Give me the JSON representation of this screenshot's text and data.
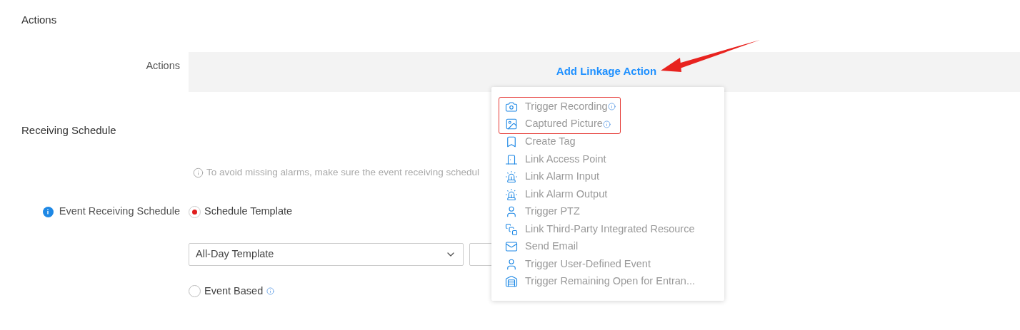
{
  "actions_section": {
    "heading": "Actions",
    "label": "Actions",
    "add_link": "Add Linkage Action"
  },
  "linkage_menu": {
    "items": [
      {
        "kind": "camera",
        "label": "Trigger Recording",
        "info": true,
        "highlighted": true
      },
      {
        "kind": "image",
        "label": "Captured Picture",
        "info": true,
        "highlighted": true
      },
      {
        "kind": "bookmark",
        "label": "Create Tag",
        "info": false,
        "highlighted": false
      },
      {
        "kind": "door",
        "label": "Link Access Point",
        "info": false,
        "highlighted": false
      },
      {
        "kind": "alarmin",
        "label": "Link Alarm Input",
        "info": false,
        "highlighted": false
      },
      {
        "kind": "alarmout",
        "label": "Link Alarm Output",
        "info": false,
        "highlighted": false
      },
      {
        "kind": "ptz",
        "label": "Trigger PTZ",
        "info": false,
        "highlighted": false
      },
      {
        "kind": "resource",
        "label": "Link Third-Party Integrated Resource",
        "info": false,
        "highlighted": false
      },
      {
        "kind": "mail",
        "label": "Send Email",
        "info": false,
        "highlighted": false
      },
      {
        "kind": "user",
        "label": "Trigger User-Defined Event",
        "info": false,
        "highlighted": false
      },
      {
        "kind": "gate",
        "label": "Trigger Remaining Open for Entran...",
        "info": false,
        "highlighted": false
      }
    ]
  },
  "schedule_section": {
    "heading": "Receiving Schedule",
    "hint": "To avoid missing alarms, make sure the event receiving schedul",
    "label": "Event Receiving Schedule",
    "options": [
      {
        "label": "Schedule Template",
        "selected": true,
        "info": false
      },
      {
        "label": "Event Based",
        "selected": false,
        "info": true
      }
    ],
    "template_select": {
      "value": "All-Day Template"
    }
  }
}
